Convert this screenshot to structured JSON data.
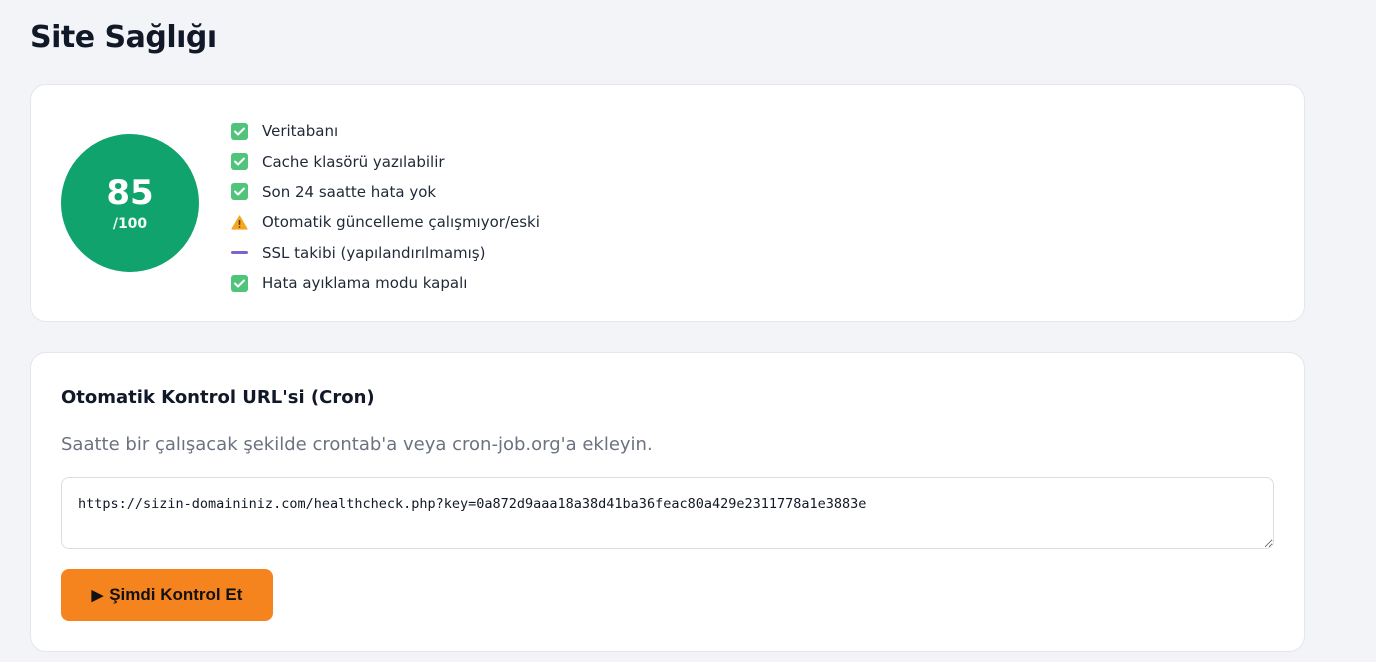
{
  "page": {
    "title": "Site Sağlığı"
  },
  "health": {
    "score": "85",
    "score_max": "/100",
    "score_color": "#10a36d",
    "checks": [
      {
        "label": "Veritabanı",
        "status": "ok",
        "icon": "check-icon"
      },
      {
        "label": "Cache klasörü yazılabilir",
        "status": "ok",
        "icon": "check-icon"
      },
      {
        "label": "Son 24 saatte hata yok",
        "status": "ok",
        "icon": "check-icon"
      },
      {
        "label": "Otomatik güncelleme çalışmıyor/eski",
        "status": "warning",
        "icon": "warning-icon"
      },
      {
        "label": "SSL takibi (yapılandırılmamış)",
        "status": "neutral",
        "icon": "dash-icon"
      },
      {
        "label": "Hata ayıklama modu kapalı",
        "status": "ok",
        "icon": "check-icon"
      }
    ]
  },
  "cron": {
    "title": "Otomatik Kontrol URL'si (Cron)",
    "description": "Saatte bir çalışacak şekilde crontab'a veya cron-job.org'a ekleyin.",
    "url": "https://sizin-domaininiz.com/healthcheck.php?key=0a872d9aaa18a38d41ba36feac80a429e2311778a1e3883e",
    "button_icon": "▶",
    "button_label": "Şimdi Kontrol Et",
    "button_color": "#f5841f"
  }
}
